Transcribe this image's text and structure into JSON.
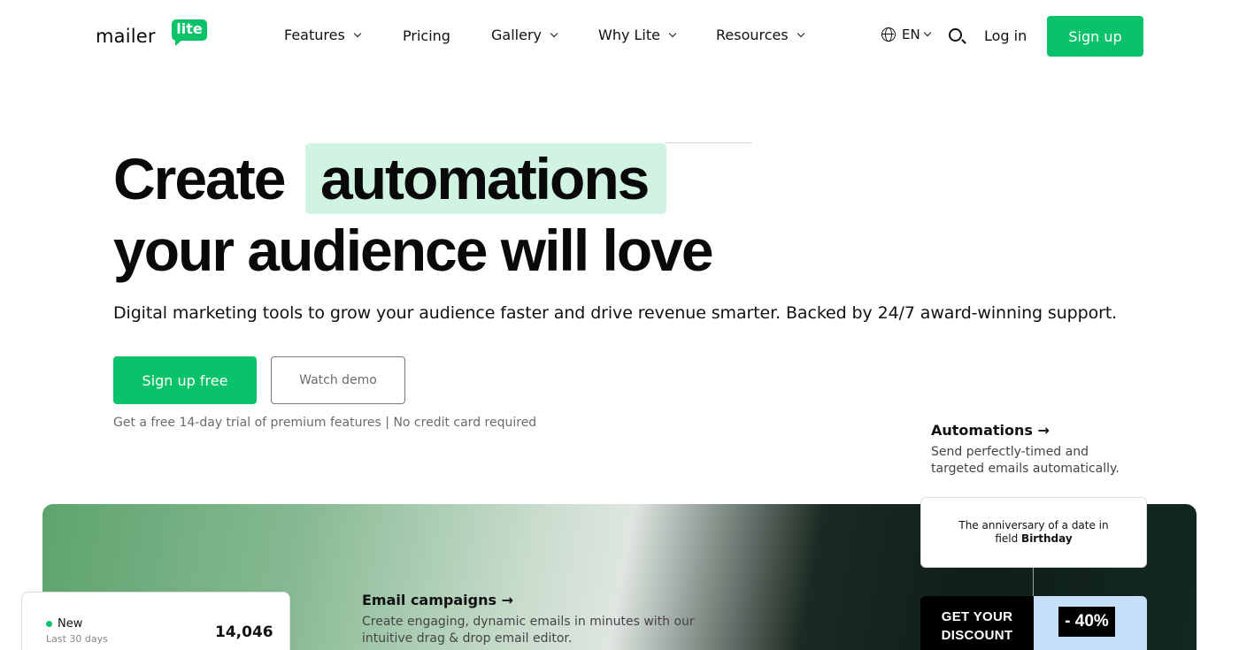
{
  "header": {
    "logo_word": "mailer",
    "logo_badge": "lite",
    "nav": [
      {
        "label": "Features",
        "has_dropdown": true
      },
      {
        "label": "Pricing",
        "has_dropdown": false
      },
      {
        "label": "Gallery",
        "has_dropdown": true
      },
      {
        "label": "Why Lite",
        "has_dropdown": true
      },
      {
        "label": "Resources",
        "has_dropdown": true
      }
    ],
    "language": "EN",
    "login_label": "Log in",
    "signup_label": "Sign up"
  },
  "hero": {
    "title_prefix": "Create",
    "title_highlight": "automations",
    "title_line2": "your audience will love",
    "subtitle": "Digital marketing tools to grow your audience faster and drive revenue smarter. Backed by 24/7 award-winning support.",
    "primary_cta": "Sign up free",
    "secondary_cta": "Watch demo",
    "trial_note": "Get a free 14-day trial of premium features | No credit card required"
  },
  "features": {
    "automations": {
      "title": "Automations →",
      "description": "Send perfectly-timed and targeted emails automatically."
    },
    "campaigns": {
      "title": "Email campaigns →",
      "description": "Create engaging, dynamic emails in minutes with our intuitive drag & drop email editor."
    }
  },
  "stat_card": {
    "label": "New",
    "period": "Last 30 days",
    "value": "14,046"
  },
  "automation_card": {
    "text_line1": "The anniversary of a date in",
    "text_line2_prefix": "field ",
    "text_line2_bold": "Birthday"
  },
  "discount_card": {
    "line1": "GET YOUR",
    "line2": "DISCOUNT",
    "badge": "- 40%"
  },
  "colors": {
    "brand_green": "#09c269",
    "highlight_bg": "#d1f3e2",
    "discount_blue": "#c6e0fb"
  }
}
